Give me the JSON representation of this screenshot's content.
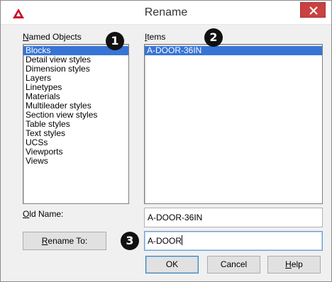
{
  "window": {
    "title": "Rename",
    "icon": "autocad-logo-icon",
    "accent": "#c94141"
  },
  "named_objects": {
    "label_prefix": "N",
    "label_rest": "amed Objects",
    "items": [
      "Blocks",
      "Detail view styles",
      "Dimension styles",
      "Layers",
      "Linetypes",
      "Materials",
      "Multileader styles",
      "Section view styles",
      "Table styles",
      "Text styles",
      "UCSs",
      "Viewports",
      "Views"
    ],
    "selected_index": 0
  },
  "items": {
    "label_prefix": "I",
    "label_rest": "tems",
    "list": [
      "A-DOOR-36IN"
    ],
    "selected_index": 0
  },
  "old_name": {
    "label_prefix": "O",
    "label_rest": "ld Name:",
    "value": "A-DOOR-36IN"
  },
  "rename_to": {
    "button_prefix": "R",
    "button_rest": "ename To:",
    "value": "A-DOOR"
  },
  "buttons": {
    "ok": "OK",
    "cancel": "Cancel",
    "help_prefix": "H",
    "help_rest": "elp"
  },
  "callouts": [
    "1",
    "2",
    "3"
  ]
}
